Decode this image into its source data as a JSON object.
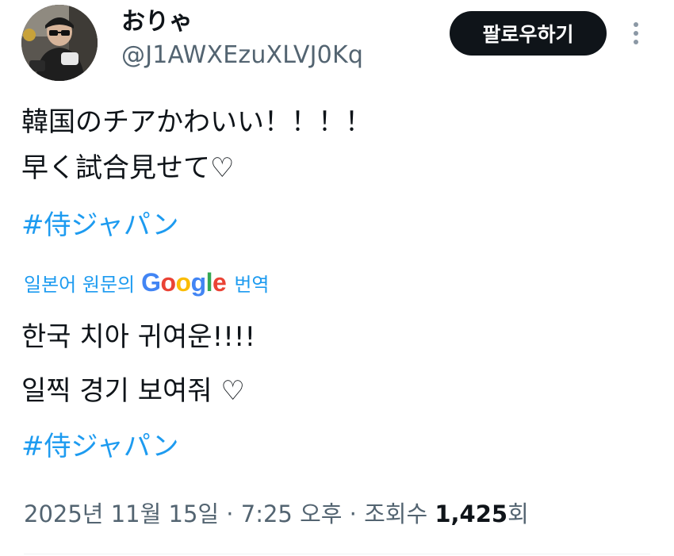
{
  "author": {
    "display_name": "おりゃ",
    "handle": "@J1AWXEzuXLVJ0Kq"
  },
  "follow_button": {
    "label": "팔로우하기"
  },
  "tweet": {
    "original_lines": [
      "韓国のチアかわいい！！！！",
      "早く試合見せて♡"
    ],
    "original_hashtag": "#侍ジャパン",
    "translation_label_prefix": "일본어 원문의",
    "translation_provider": "Google",
    "translation_label_suffix": "번역",
    "translated_lines": [
      "한국 치아 귀여운!!!!",
      "일찍 경기 보여줘 ♡"
    ],
    "translated_hashtag": "#侍ジャパン"
  },
  "meta": {
    "timestamp": "2025년 11월 15일 · 7:25 오후 · 조회수",
    "views_count": "1,425",
    "views_suffix": "회"
  },
  "colors": {
    "link": "#1d9bf0",
    "text": "#0f1419",
    "secondary": "#536471",
    "button_bg": "#0f1419"
  },
  "icons": {
    "more": "more-vertical-icon"
  }
}
